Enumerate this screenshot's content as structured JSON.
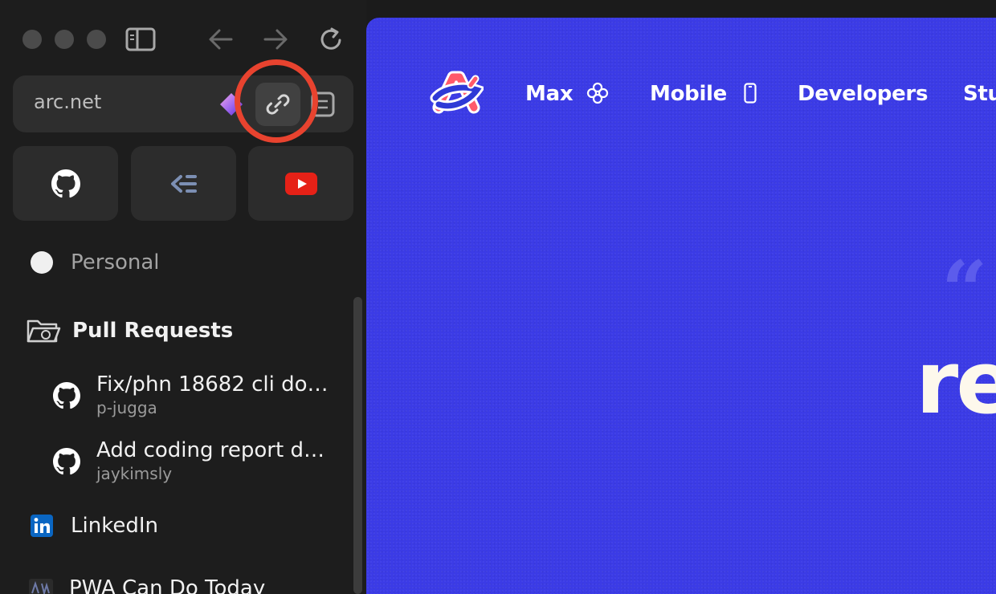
{
  "browser": {
    "url": "arc.net",
    "favorites": [
      {
        "name": "GitHub",
        "icon": "github-icon"
      },
      {
        "name": "Linear",
        "icon": "linear-icon"
      },
      {
        "name": "YouTube",
        "icon": "youtube-icon"
      }
    ],
    "space_name": "Personal",
    "folder": {
      "label": "Pull Requests",
      "items": [
        {
          "title": "Fix/phn 18682 cli do…",
          "subtitle": "p-jugga"
        },
        {
          "title": "Add coding report d…",
          "subtitle": "jaykimsly"
        }
      ]
    },
    "pinned": [
      {
        "label": "LinkedIn"
      },
      {
        "label": "PWA Can Do Today"
      }
    ]
  },
  "page": {
    "nav": [
      "Max",
      "Mobile",
      "Developers",
      "Stu"
    ],
    "headline_fragment": "re",
    "quote_mark": "“"
  },
  "colors": {
    "sidebar_bg": "#1d1d1d",
    "urlbar_bg": "#2e2e2e",
    "page_blue": "#3b3be6",
    "highlight_red": "#e8432f",
    "headline_cream": "#fdf8ec"
  }
}
